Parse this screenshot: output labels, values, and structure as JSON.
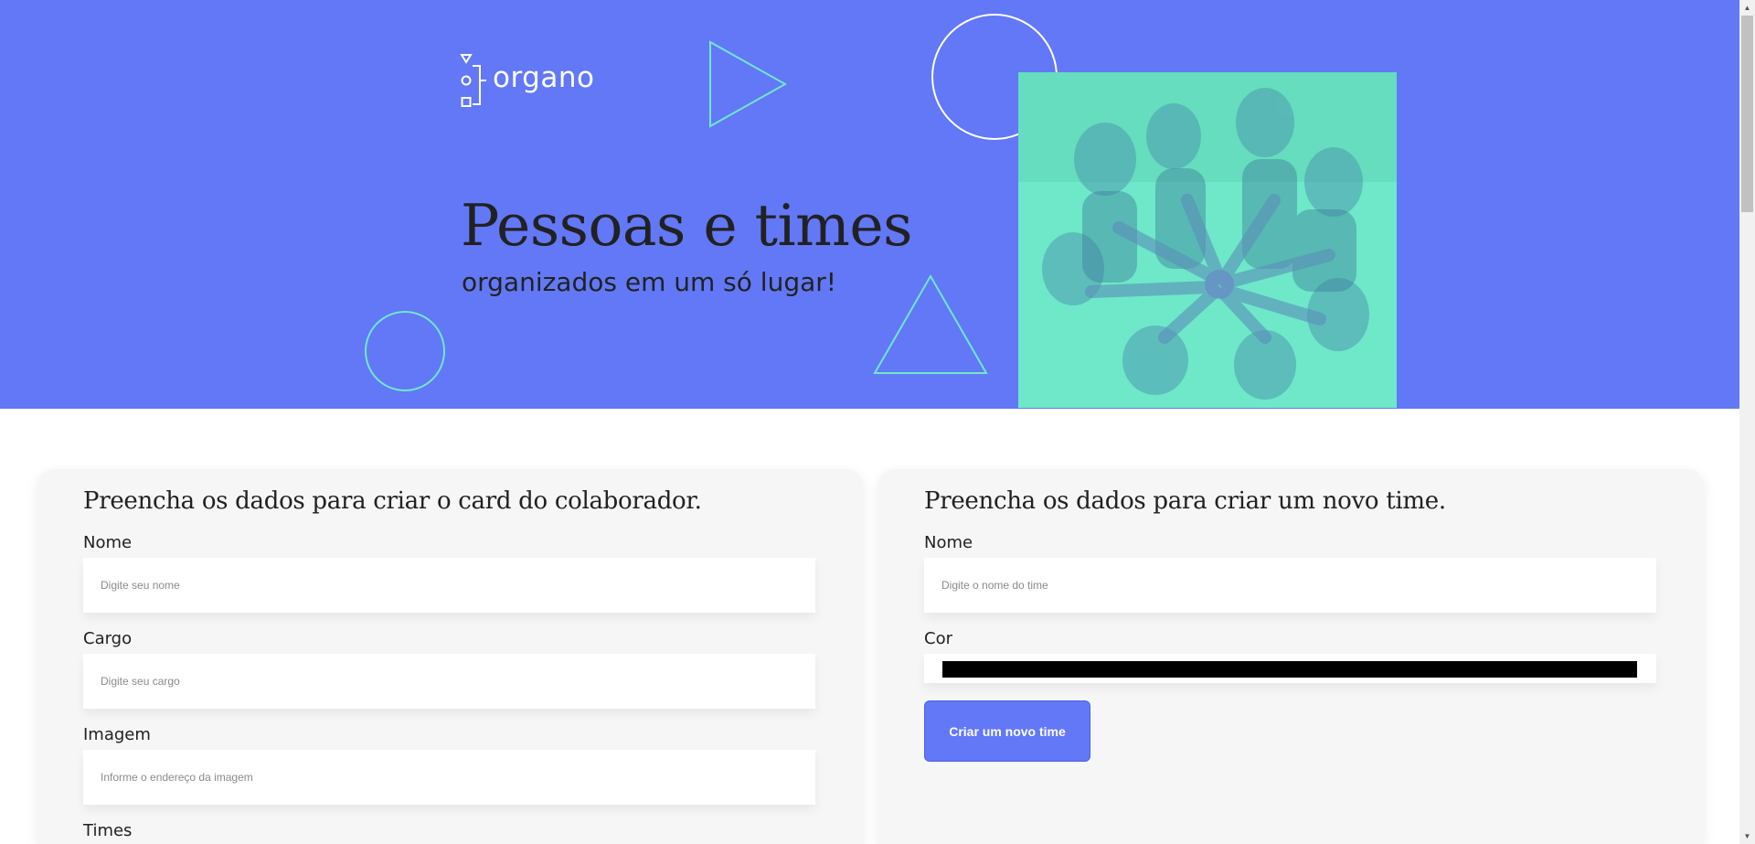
{
  "brand": {
    "logo_text": "organo",
    "primary": "#6278f7",
    "accent": "#6ee8c9"
  },
  "banner": {
    "headline": "Pessoas e times",
    "subline": "organizados em um só lugar!",
    "photo_icon": "team-hands-photo"
  },
  "collaborator_form": {
    "title": "Preencha os dados para criar o card do colaborador.",
    "fields": [
      {
        "label": "Nome",
        "placeholder": "Digite seu nome"
      },
      {
        "label": "Cargo",
        "placeholder": "Digite seu cargo"
      },
      {
        "label": "Imagem",
        "placeholder": "Informe o endereço da imagem"
      },
      {
        "label": "Times"
      }
    ]
  },
  "team_form": {
    "title": "Preencha os dados para criar um novo time.",
    "name_label": "Nome",
    "name_placeholder": "Digite o nome do time",
    "color_label": "Cor",
    "color_value": "#000000",
    "submit_label": "Criar um novo time"
  },
  "scrollbar": {
    "up_icon": "arrow-up-icon",
    "down_icon": "arrow-down-icon"
  }
}
